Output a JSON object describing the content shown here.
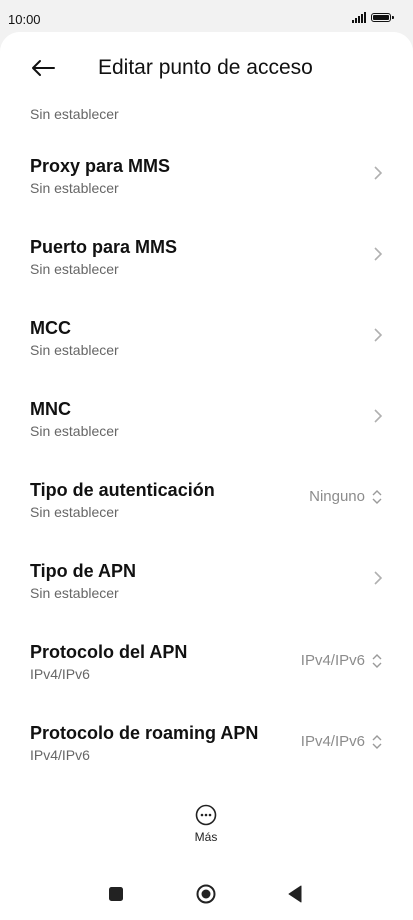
{
  "status": {
    "time": "10:00"
  },
  "header": {
    "title": "Editar punto de acceso"
  },
  "rows": [
    {
      "title": "",
      "subtitle": "Sin establecer"
    },
    {
      "title": "Proxy para MMS",
      "subtitle": "Sin establecer"
    },
    {
      "title": "Puerto para MMS",
      "subtitle": "Sin establecer"
    },
    {
      "title": "MCC",
      "subtitle": "Sin establecer"
    },
    {
      "title": "MNC",
      "subtitle": "Sin establecer"
    },
    {
      "title": "Tipo de autenticación",
      "subtitle": "Sin establecer",
      "value": "Ninguno"
    },
    {
      "title": "Tipo de APN",
      "subtitle": "Sin establecer"
    },
    {
      "title": "Protocolo del APN",
      "subtitle": "IPv4/IPv6",
      "value": "IPv4/IPv6"
    },
    {
      "title": "Protocolo de roaming APN",
      "subtitle": "IPv4/IPv6",
      "value": "IPv4/IPv6"
    }
  ],
  "more": {
    "label": "Más"
  },
  "icons": {
    "back": "arrow-left-icon",
    "chevron": "chevron-right-icon",
    "selector": "up-down-chevron-icon",
    "more": "more-horizontal-circle-icon",
    "nav_recents": "square-icon",
    "nav_home": "circle-icon",
    "nav_back": "triangle-left-icon"
  }
}
